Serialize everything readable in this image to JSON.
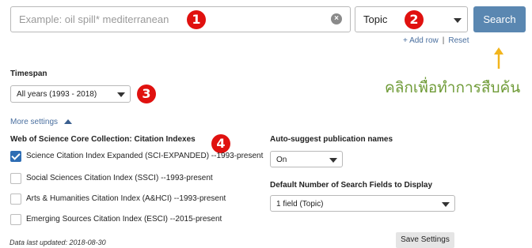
{
  "search": {
    "placeholder": "Example: oil spill* mediterranean",
    "clear_icon": "×"
  },
  "field_select": {
    "value": "Topic"
  },
  "search_button": {
    "label": "Search"
  },
  "row_links": {
    "add_row": "+ Add row",
    "separator": "|",
    "reset": "Reset"
  },
  "annotations": {
    "badge1": "1",
    "badge2": "2",
    "badge3": "3",
    "badge4": "4",
    "thai_note": "คลิกเพื่อทำการสืบค้น",
    "arrow_color": "#f2b51d",
    "badge_color": "#e0110f"
  },
  "timespan": {
    "label": "Timespan",
    "value": "All years (1993 - 2018)"
  },
  "more_settings": {
    "label": "More settings"
  },
  "citation_indexes": {
    "heading": "Web of Science Core Collection: Citation Indexes",
    "items": [
      {
        "label": "Science Citation Index Expanded (SCI-EXPANDED) --1993-present",
        "checked": true
      },
      {
        "label": "Social Sciences Citation Index (SSCI) --1993-present",
        "checked": false
      },
      {
        "label": "Arts & Humanities Citation Index (A&HCI) --1993-present",
        "checked": false
      },
      {
        "label": "Emerging Sources Citation Index (ESCI) --2015-present",
        "checked": false
      }
    ]
  },
  "auto_suggest": {
    "label": "Auto-suggest publication names",
    "value": "On"
  },
  "default_fields": {
    "label": "Default Number of Search Fields to Display",
    "value": "1 field (Topic)"
  },
  "save_settings": {
    "label": "Save Settings"
  },
  "last_updated": {
    "text": "Data last updated: 2018-08-30"
  },
  "colors": {
    "primary_button": "#5a87b1",
    "link": "#4a6f9f",
    "checkbox_checked": "#2e6db4",
    "thai_text": "#6f9b37"
  }
}
